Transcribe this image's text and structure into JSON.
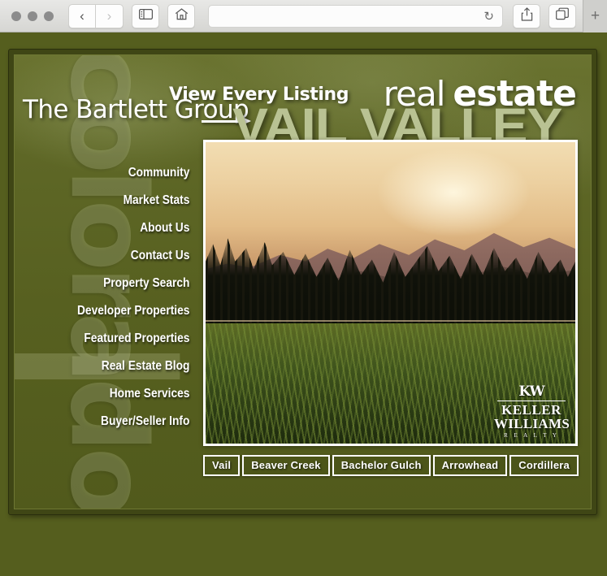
{
  "browser": {
    "window_controls": [
      "close",
      "minimize",
      "zoom"
    ],
    "back_label": "‹",
    "forward_label": "›",
    "sidebar_icon": "sidebar-icon",
    "home_icon": "home-icon",
    "address_value": "",
    "address_placeholder": "",
    "reload_label": "↻",
    "share_icon": "share-icon",
    "tabs_icon": "tabs-icon",
    "new_tab_label": "+"
  },
  "site": {
    "watermark": "colorado",
    "company": "The Bartlett Group",
    "tagline": "View Every Listing",
    "brand_line1_thin": "real",
    "brand_line1_bold": "estate",
    "brand_line2": "VAIL VALLEY",
    "nav": [
      {
        "label": "Community",
        "active": false
      },
      {
        "label": "Market Stats",
        "active": false
      },
      {
        "label": "About Us",
        "active": false
      },
      {
        "label": "Contact Us",
        "active": false
      },
      {
        "label": "Property Search",
        "active": false
      },
      {
        "label": "Developer Properties",
        "active": false
      },
      {
        "label": "Featured Properties",
        "active": false
      },
      {
        "label": "Real Estate Blog",
        "active": true
      },
      {
        "label": "Home Services",
        "active": false
      },
      {
        "label": "Buyer/Seller Info",
        "active": false
      }
    ],
    "hero_photo": {
      "description": "Mountain lake at sunset with pine forest, peaks and purple wildflower meadow"
    },
    "realty_logo": {
      "monogram": "KW",
      "line1": "KELLER",
      "line2": "WILLIAMS",
      "line3": "R E A L T Y"
    },
    "areas": [
      {
        "label": "Vail"
      },
      {
        "label": "Beaver Creek"
      },
      {
        "label": "Bachelor Gulch"
      },
      {
        "label": "Arrowhead"
      },
      {
        "label": "Cordillera"
      }
    ]
  },
  "colors": {
    "page_background": "#555e1e",
    "frame_dark": "#3f4615",
    "panel": "#5a6323",
    "heading_light_green": "#b9c293",
    "text_white": "#ffffff",
    "button_fill": "#4c5519"
  }
}
